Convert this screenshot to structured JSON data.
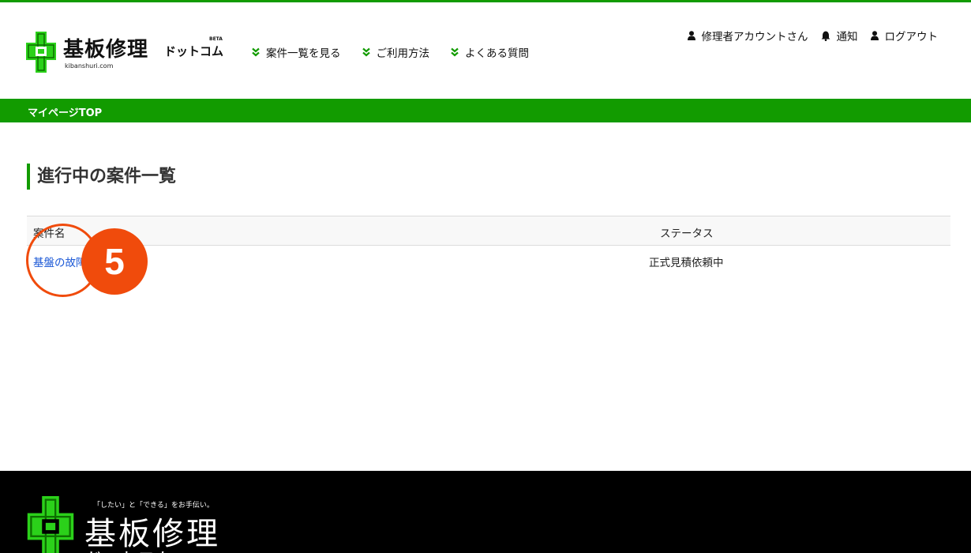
{
  "brand": {
    "logo_text": "基板修理",
    "logo_suffix": "ドットコム",
    "beta_label": "BETA",
    "domain": "kibanshuri.com",
    "accent_color": "#129b00"
  },
  "nav": {
    "items": [
      {
        "label": "案件一覧を見る",
        "icon": "chevron-double-down-icon"
      },
      {
        "label": "ご利用方法",
        "icon": "chevron-double-down-icon"
      },
      {
        "label": "よくある質問",
        "icon": "chevron-double-down-icon"
      }
    ]
  },
  "user_menu": {
    "account": {
      "label": "修理者アカウントさん",
      "icon": "user-icon"
    },
    "notifications": {
      "label": "通知",
      "icon": "bell-icon"
    },
    "logout": {
      "label": "ログアウト",
      "icon": "user-icon"
    }
  },
  "breadcrumb": {
    "label": "マイページTOP"
  },
  "main": {
    "title": "進行中の案件一覧",
    "table": {
      "headers": [
        "案件名",
        "ステータス"
      ],
      "rows": [
        {
          "name": "基盤の故障",
          "status": "正式見積依頼中"
        }
      ]
    }
  },
  "annotation": {
    "step_number": "5",
    "color": "#f04b0c"
  },
  "footer": {
    "tagline": "「したい」と「できる」をお手伝い。",
    "logo_text": "基板修理",
    "logo_suffix": "ドットコム"
  }
}
